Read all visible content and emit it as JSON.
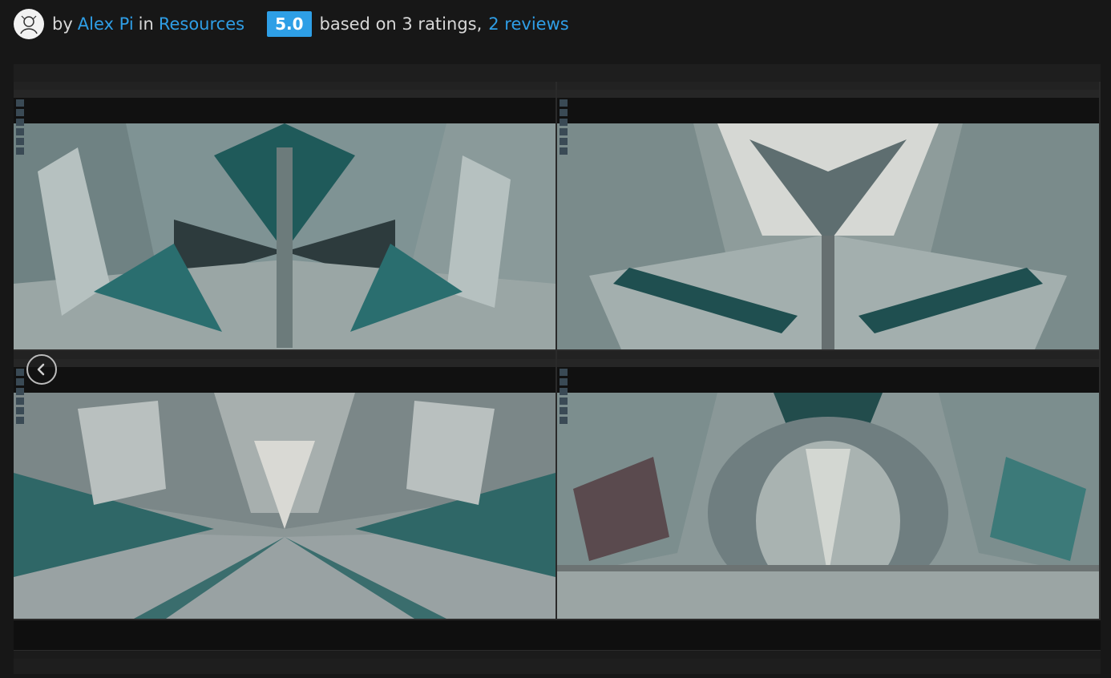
{
  "header": {
    "by": "by",
    "author": "Alex Pi",
    "in": "in",
    "category": "Resources",
    "rating": "5.0",
    "based_on": "based on 3 ratings,",
    "reviews": "2 reviews"
  },
  "gallery": {
    "prev_icon": "chevron-left-icon"
  },
  "colors": {
    "link": "#2f9ee6",
    "rating_badge": "#2e9fe6",
    "background": "#171717"
  }
}
